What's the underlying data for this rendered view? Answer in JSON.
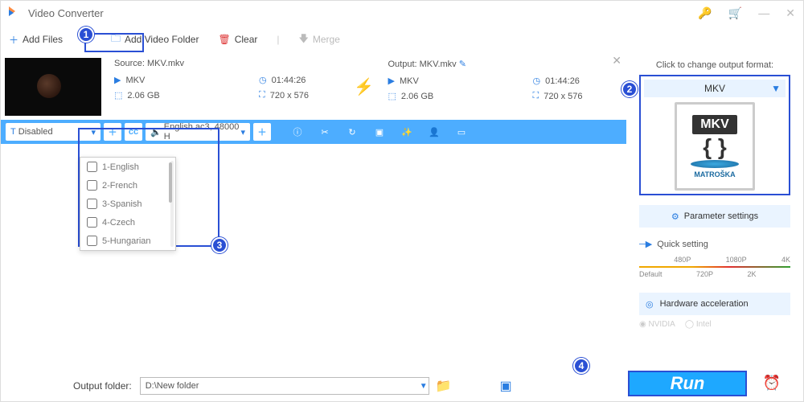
{
  "title": "Video Converter",
  "toolbar": {
    "add_files": "Add Files",
    "add_folder": "Add Video Folder",
    "clear": "Clear",
    "merge": "Merge"
  },
  "file": {
    "source_label": "Source:",
    "source_name": "MKV.mkv",
    "output_label": "Output:",
    "output_name": "MKV.mkv",
    "src": {
      "fmt": "MKV",
      "dur": "01:44:26",
      "size": "2.06 GB",
      "res": "720 x 576"
    },
    "out": {
      "fmt": "MKV",
      "dur": "01:44:26",
      "size": "2.06 GB",
      "res": "720 x 576"
    }
  },
  "subbar": {
    "text_sel": "Disabled",
    "cc": "cc",
    "audio_sel": "English ac3, 48000 H"
  },
  "subtitle_opts": [
    "1-English",
    "2-French",
    "3-Spanish",
    "4-Czech",
    "5-Hungarian"
  ],
  "right": {
    "hint": "Click to change output format:",
    "fmt": "MKV",
    "mkv_brand": "MATROŠKA",
    "param": "Parameter settings",
    "quick": "Quick setting",
    "slider_top": [
      "",
      "480P",
      "1080P",
      "4K"
    ],
    "slider_bot": [
      "Default",
      "720P",
      "2K",
      ""
    ],
    "hw": "Hardware acceleration",
    "nvidia": "NVIDIA",
    "intel": "Intel"
  },
  "bottom": {
    "label": "Output folder:",
    "path": "D:\\New folder",
    "run": "Run"
  },
  "markers": {
    "1": "1",
    "2": "2",
    "3": "3",
    "4": "4"
  }
}
